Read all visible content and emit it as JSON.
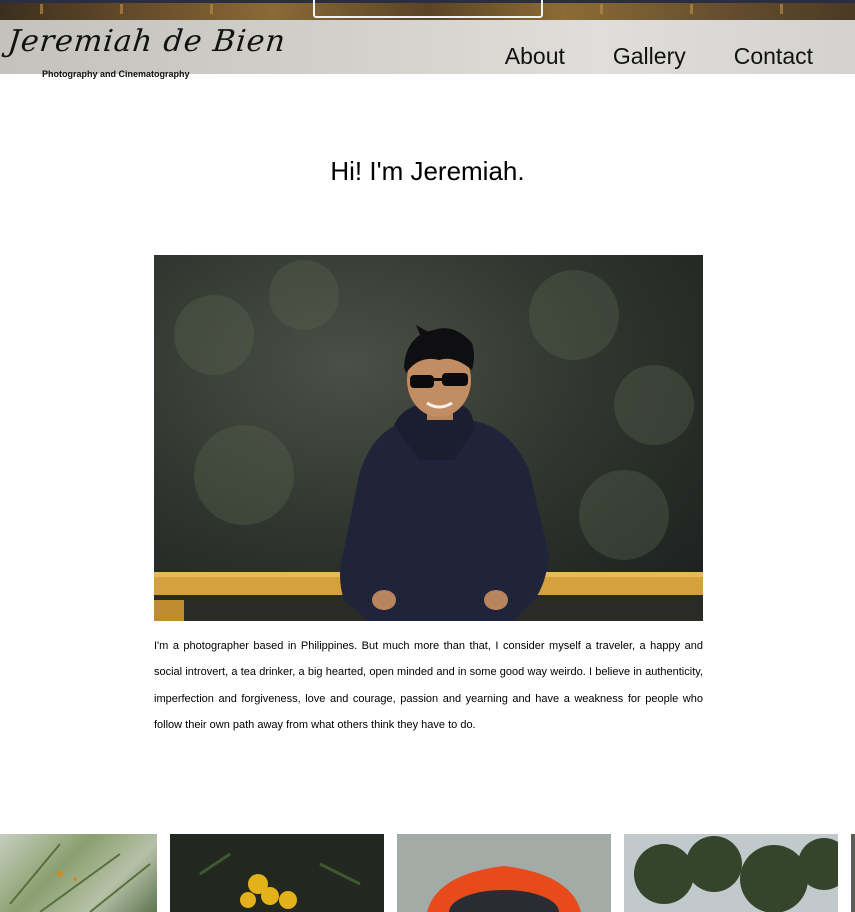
{
  "header": {
    "logo_script": "Jeremiah de Bien",
    "logo_tagline": "Photography and Cinematography",
    "nav": [
      "About",
      "Gallery",
      "Contact"
    ]
  },
  "main": {
    "title": "Hi! I'm Jeremiah.",
    "bio": "I'm a photographer based in Philippines. But much more than that, I consider myself a traveler, a happy and social introvert, a tea drinker, a big hearted, open minded and in some good way weirdo. I believe in authenticity, imperfection and forgiveness, love and courage, passion and yearning and have a weakness for people who follow their own path away from what others think they have to do."
  },
  "colors": {
    "header_band": "#d2d0ca",
    "text": "#000000",
    "railing": "#d4a13c"
  }
}
